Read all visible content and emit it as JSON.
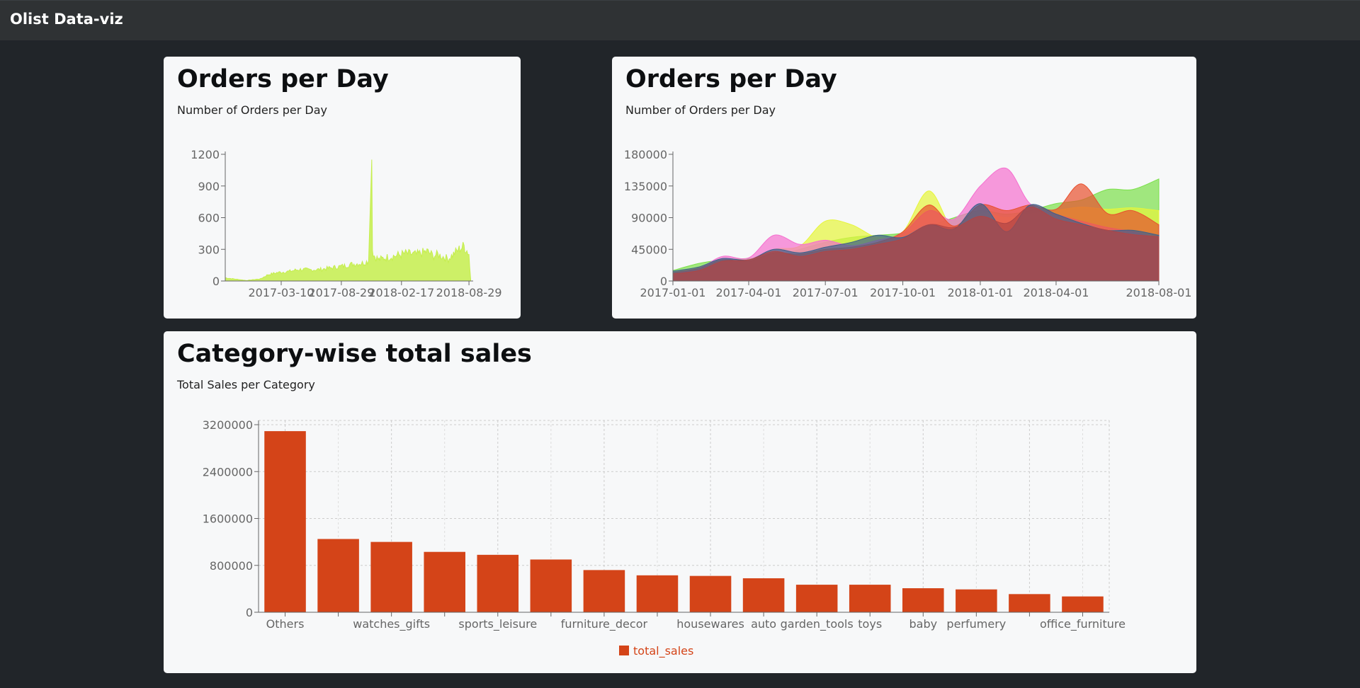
{
  "navbar": {
    "brand": "Olist Data-viz"
  },
  "cards": [
    {
      "title": "Orders per Day",
      "subtitle": "Number of Orders per Day"
    },
    {
      "title": "Orders per Day",
      "subtitle": "Number of Orders per Day"
    },
    {
      "title": "Category-wise total sales",
      "subtitle": "Total Sales per Category"
    }
  ],
  "chart_data": [
    {
      "type": "area",
      "title": "Orders per Day",
      "subtitle": "Number of Orders per Day",
      "x_ticks": [
        "2017-03-10",
        "2017-08-29",
        "2018-02-17",
        "2018-08-29"
      ],
      "y_ticks": [
        0,
        300,
        600,
        900,
        1200
      ],
      "ylim": [
        0,
        1200
      ],
      "xlim": [
        "2016-10-01",
        "2018-09-10"
      ],
      "color": "#c5ee4d",
      "series": [
        {
          "x": [
            "2016-10-01",
            "2016-12-01",
            "2017-01-10",
            "2017-02-01",
            "2017-03-01",
            "2017-04-01",
            "2017-05-01",
            "2017-06-01",
            "2017-07-01",
            "2017-08-01",
            "2017-09-01",
            "2017-10-01",
            "2017-11-01",
            "2017-11-15",
            "2017-11-24",
            "2017-11-26",
            "2017-12-01",
            "2017-12-15",
            "2018-01-01",
            "2018-02-01",
            "2018-03-01",
            "2018-04-01",
            "2018-05-01",
            "2018-05-20",
            "2018-06-01",
            "2018-07-01",
            "2018-08-01",
            "2018-08-15",
            "2018-08-29",
            "2018-09-03"
          ],
          "y": [
            30,
            5,
            20,
            60,
            80,
            90,
            110,
            105,
            110,
            125,
            140,
            160,
            170,
            190,
            1150,
            300,
            240,
            200,
            220,
            240,
            260,
            250,
            280,
            240,
            250,
            210,
            300,
            330,
            260,
            10
          ]
        }
      ]
    },
    {
      "type": "area",
      "title": "Orders per Day",
      "subtitle": "Number of Orders per Day",
      "x_ticks": [
        "2017-01-01",
        "2017-04-01",
        "2017-07-01",
        "2017-10-01",
        "2018-01-01",
        "2018-04-01",
        "2018-08-01"
      ],
      "y_ticks": [
        0,
        45000,
        90000,
        135000,
        180000
      ],
      "ylim": [
        0,
        180000
      ],
      "xlim": [
        "2017-01-01",
        "2018-08-01"
      ],
      "series": [
        {
          "color": "#7be04a",
          "x": [
            "2017-01-01",
            "2017-02-01",
            "2017-03-01",
            "2017-04-01",
            "2017-05-01",
            "2017-06-01",
            "2017-07-01",
            "2017-08-01",
            "2017-09-01",
            "2017-10-01",
            "2017-11-01",
            "2017-12-01",
            "2018-01-01",
            "2018-02-01",
            "2018-03-01",
            "2018-04-01",
            "2018-05-01",
            "2018-06-01",
            "2018-07-01",
            "2018-08-01"
          ],
          "y": [
            15000,
            25000,
            30000,
            32000,
            34000,
            45000,
            55000,
            62000,
            65000,
            68000,
            78000,
            90000,
            100000,
            95000,
            100000,
            110000,
            115000,
            130000,
            130000,
            145000
          ]
        },
        {
          "color": "#e6f53a",
          "x": [
            "2017-01-01",
            "2017-02-01",
            "2017-03-01",
            "2017-04-01",
            "2017-05-01",
            "2017-06-01",
            "2017-07-01",
            "2017-08-01",
            "2017-09-01",
            "2017-10-01",
            "2017-11-01",
            "2017-12-01",
            "2018-01-01",
            "2018-02-01",
            "2018-03-01",
            "2018-04-01",
            "2018-05-01",
            "2018-06-01",
            "2018-07-01",
            "2018-08-01"
          ],
          "y": [
            12000,
            20000,
            28000,
            30000,
            45000,
            50000,
            85000,
            80000,
            62000,
            70000,
            128000,
            72000,
            95000,
            90000,
            95000,
            100000,
            105000,
            102000,
            104000,
            100000
          ]
        },
        {
          "color": "#f56fcf",
          "x": [
            "2017-01-01",
            "2017-02-01",
            "2017-03-01",
            "2017-04-01",
            "2017-05-01",
            "2017-06-01",
            "2017-07-01",
            "2017-08-01",
            "2017-09-01",
            "2017-10-01",
            "2017-11-01",
            "2017-12-01",
            "2018-01-01",
            "2018-02-01",
            "2018-03-01",
            "2018-04-01",
            "2018-05-01",
            "2018-06-01",
            "2018-07-01",
            "2018-08-01"
          ],
          "y": [
            10000,
            18000,
            35000,
            33000,
            65000,
            52000,
            58000,
            50000,
            58000,
            68000,
            100000,
            88000,
            135000,
            160000,
            110000,
            95000,
            85000,
            76000,
            70000,
            60000
          ]
        },
        {
          "color": "#e8502e",
          "x": [
            "2017-01-01",
            "2017-02-01",
            "2017-03-01",
            "2017-04-01",
            "2017-05-01",
            "2017-06-01",
            "2017-07-01",
            "2017-08-01",
            "2017-09-01",
            "2017-10-01",
            "2017-11-01",
            "2017-12-01",
            "2018-01-01",
            "2018-02-01",
            "2018-03-01",
            "2018-04-01",
            "2018-05-01",
            "2018-06-01",
            "2018-07-01",
            "2018-08-01"
          ],
          "y": [
            12000,
            18000,
            30000,
            28000,
            40000,
            38000,
            45000,
            48000,
            55000,
            70000,
            108000,
            78000,
            108000,
            100000,
            108000,
            102000,
            138000,
            96000,
            100000,
            80000
          ]
        },
        {
          "color": "#3e5f8a",
          "x": [
            "2017-01-01",
            "2017-02-01",
            "2017-03-01",
            "2017-04-01",
            "2017-05-01",
            "2017-06-01",
            "2017-07-01",
            "2017-08-01",
            "2017-09-01",
            "2017-10-01",
            "2017-11-01",
            "2017-12-01",
            "2018-01-01",
            "2018-02-01",
            "2018-03-01",
            "2018-04-01",
            "2018-05-01",
            "2018-06-01",
            "2018-07-01",
            "2018-08-01"
          ],
          "y": [
            14000,
            20000,
            32000,
            30000,
            45000,
            40000,
            48000,
            55000,
            65000,
            62000,
            80000,
            74000,
            110000,
            70000,
            108000,
            95000,
            82000,
            72000,
            72000,
            65000
          ]
        },
        {
          "color": "#b04545",
          "x": [
            "2017-01-01",
            "2017-02-01",
            "2017-03-01",
            "2017-04-01",
            "2017-05-01",
            "2017-06-01",
            "2017-07-01",
            "2017-08-01",
            "2017-09-01",
            "2017-10-01",
            "2017-11-01",
            "2017-12-01",
            "2018-01-01",
            "2018-02-01",
            "2018-03-01",
            "2018-04-01",
            "2018-05-01",
            "2018-06-01",
            "2018-07-01",
            "2018-08-01"
          ],
          "y": [
            10000,
            15000,
            28000,
            30000,
            42000,
            35000,
            42000,
            45000,
            52000,
            60000,
            80000,
            76000,
            92000,
            82000,
            105000,
            88000,
            80000,
            72000,
            66000,
            63000
          ]
        }
      ]
    },
    {
      "type": "bar",
      "title": "Category-wise total sales",
      "subtitle": "Total Sales per Category",
      "categories": [
        "Others",
        "",
        "watches_gifts",
        "",
        "sports_leisure",
        "",
        "furniture_decor",
        "",
        "housewares",
        "auto",
        "garden_tools",
        "toys",
        "baby",
        "perfumery",
        "",
        "office_furniture"
      ],
      "values": [
        3090000,
        1250000,
        1200000,
        1030000,
        980000,
        900000,
        720000,
        630000,
        620000,
        580000,
        470000,
        470000,
        410000,
        390000,
        310000,
        270000
      ],
      "y_ticks": [
        0,
        800000,
        1600000,
        2400000,
        3200000
      ],
      "ylim": [
        0,
        3200000
      ],
      "grid": true,
      "legend": "bottom",
      "series_name": "total_sales",
      "color": "#d44418"
    }
  ]
}
